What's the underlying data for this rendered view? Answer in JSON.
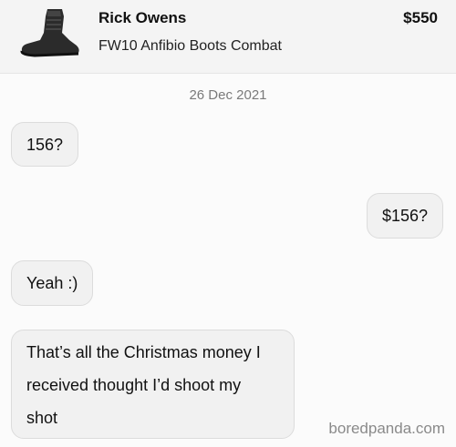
{
  "listing": {
    "brand": "Rick Owens",
    "price": "$550",
    "title": "FW10 Anfibio Boots Combat",
    "thumbnail_icon": "boot-photo"
  },
  "chat": {
    "date": "26 Dec 2021",
    "messages": [
      {
        "side": "left",
        "text": "156?"
      },
      {
        "side": "right",
        "text": "$156?"
      },
      {
        "side": "left",
        "text": "Yeah :)"
      },
      {
        "side": "left",
        "lines": [
          "That’s all the Christmas money I",
          "received thought I’d shoot my",
          "shot"
        ]
      }
    ]
  },
  "watermark": "boredpanda.com",
  "colors": {
    "bubble": "#f1f1f1",
    "header": "#f4f4f4",
    "muted": "#7a7a7a"
  }
}
